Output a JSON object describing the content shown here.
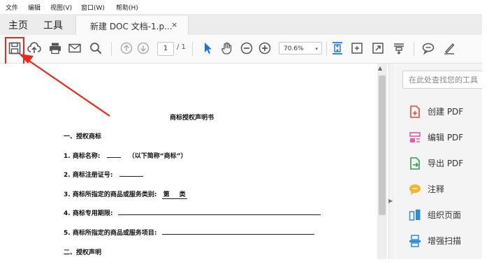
{
  "menu": [
    "文件",
    "编辑",
    "视图(V)",
    "窗口(W)",
    "帮助(H)"
  ],
  "nav": {
    "home": "主页",
    "tools": "工具"
  },
  "tab": {
    "title": "新建 DOC 文档-1.p...",
    "close": "×"
  },
  "toolbar": {
    "page_current": "1",
    "page_total": "/ 1",
    "zoom": "70.6%",
    "zoom_arrow": "▾"
  },
  "document": {
    "title": "商标授权声明书",
    "section1": "一、授权商标",
    "item1_label": "1. 商标名称:",
    "item1_suffix": "（以下简称“商标”）",
    "item2_label": "2. 商标注册证号:",
    "item3_label": "3. 商标所指定的商品或服务类别:",
    "item3_fill_a": "第",
    "item3_fill_b": "类",
    "item4_label": "4. 商标专用期限:",
    "item5_label": "5. 商标所指定的商品或服务项目:",
    "section2": "二、授权声明"
  },
  "right_panel": {
    "search_placeholder": "在此处查找您的工具",
    "tools": [
      {
        "label": "创建 PDF",
        "icon": "create-pdf-icon",
        "color": "#e34a3b"
      },
      {
        "label": "编辑 PDF",
        "icon": "edit-pdf-icon",
        "color": "#e85aa8"
      },
      {
        "label": "导出 PDF",
        "icon": "export-pdf-icon",
        "color": "#3a9a52"
      },
      {
        "label": "注释",
        "icon": "comment-icon",
        "color": "#f2b52c"
      },
      {
        "label": "组织页面",
        "icon": "organize-pages-icon",
        "color": "#2e8bd6"
      },
      {
        "label": "增强扫描",
        "icon": "enhance-scan-icon",
        "color": "#2e8bd6"
      }
    ]
  },
  "annotation": {
    "highlight_color": "#e8291c"
  }
}
